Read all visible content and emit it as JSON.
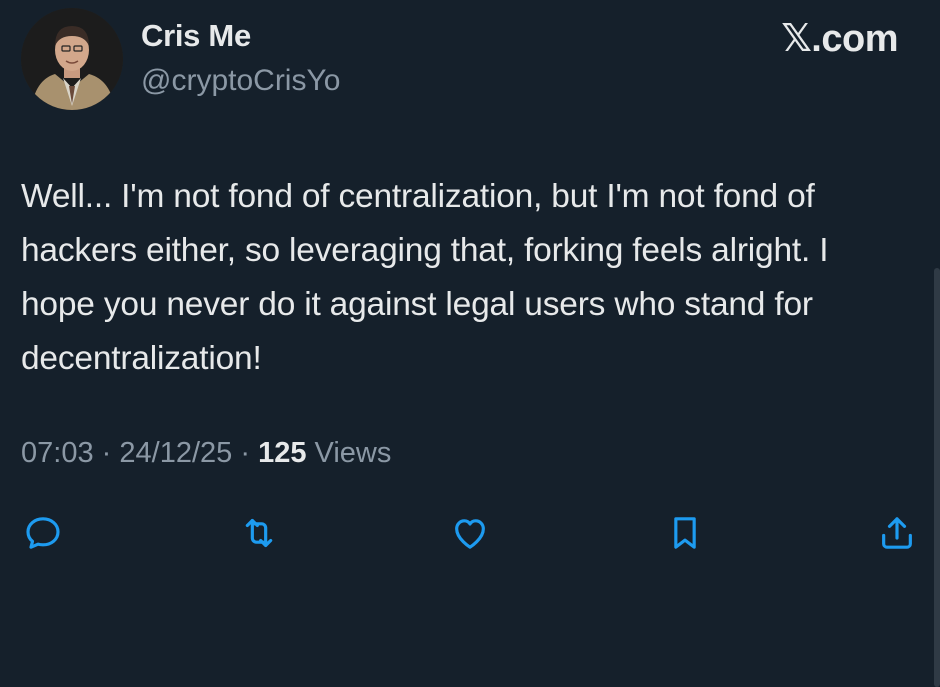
{
  "header": {
    "display_name": "Cris Me",
    "handle": "@cryptoCrisYo",
    "brand": "𝕏.com"
  },
  "tweet": {
    "text": "Well... I'm not fond of centralization, but I'm not fond of hackers either, so leveraging that, forking feels alright. I hope you never do it against legal users who stand for decentralization!",
    "time": "07:03",
    "separator": "·",
    "date": "24/12/25",
    "views_count": "125",
    "views_label": "Views"
  },
  "actions": {
    "icons": [
      "reply-icon",
      "retweet-icon",
      "like-icon",
      "bookmark-icon",
      "share-icon"
    ]
  },
  "colors": {
    "background": "#15202b",
    "text": "#e7e9ea",
    "secondary": "#8b98a5",
    "icon": "#1d9bf0"
  }
}
